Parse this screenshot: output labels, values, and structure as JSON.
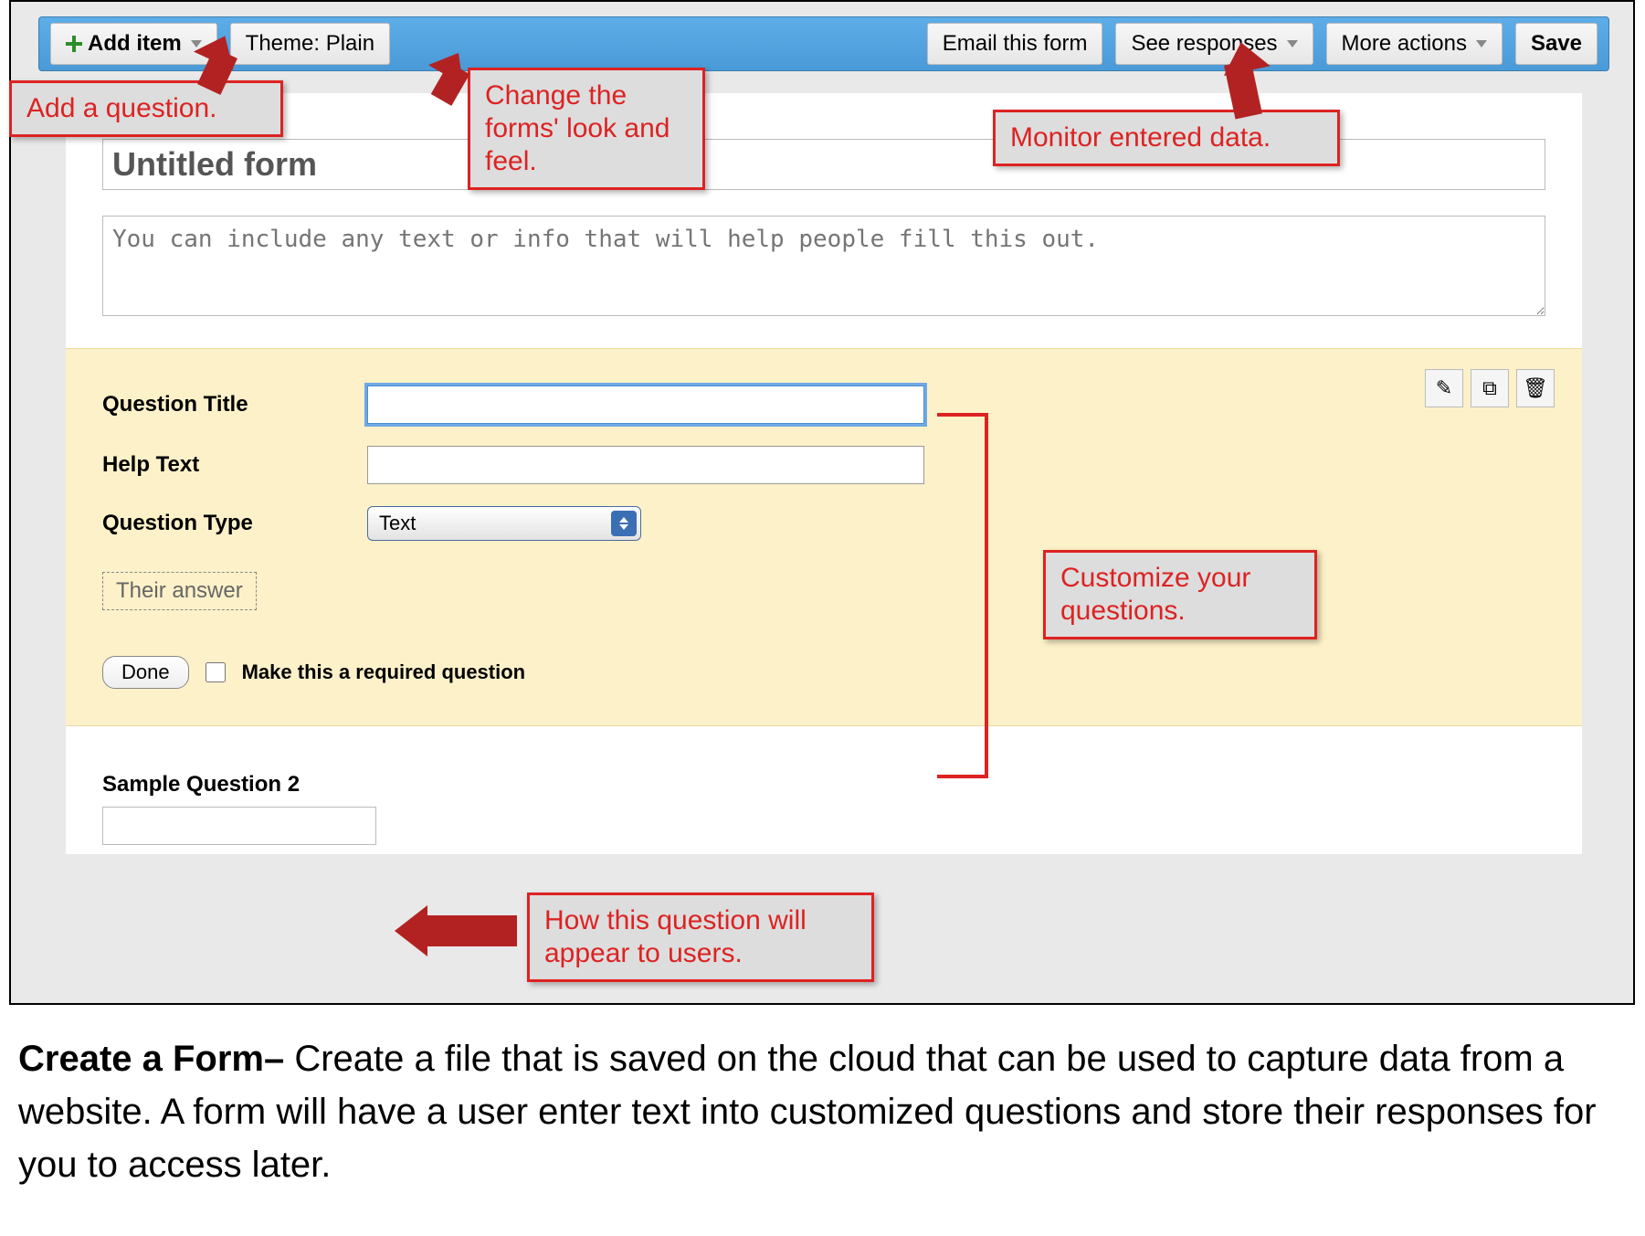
{
  "toolbar": {
    "add_item_label": "Add item",
    "theme_label": "Theme:  Plain",
    "email_label": "Email this form",
    "responses_label": "See responses",
    "more_label": "More actions",
    "save_label": "Save"
  },
  "form": {
    "title_value": "Untitled form",
    "description_placeholder": "You can include any text or info that will help people fill this out."
  },
  "editor": {
    "question_title_label": "Question Title",
    "help_text_label": "Help Text",
    "question_type_label": "Question Type",
    "question_type_value": "Text",
    "answer_placeholder": "Their answer",
    "done_label": "Done",
    "required_label": "Make this a required question",
    "tools": {
      "edit": "✎",
      "duplicate": "⧉",
      "delete": "🗑"
    }
  },
  "sample": {
    "label": "Sample Question 2"
  },
  "annotations": {
    "add_question": "Add a question.",
    "change_theme": "Change the forms' look and feel.",
    "monitor_data": "Monitor entered data.",
    "customize": "Customize your questions.",
    "appear": "How this question will appear to users."
  },
  "caption": {
    "heading": "Create a Form–",
    "body": " Create a file that is saved on the cloud that can be used to capture data from a website.  A form will have a user enter text into customized questions and store their responses for you to access later."
  }
}
